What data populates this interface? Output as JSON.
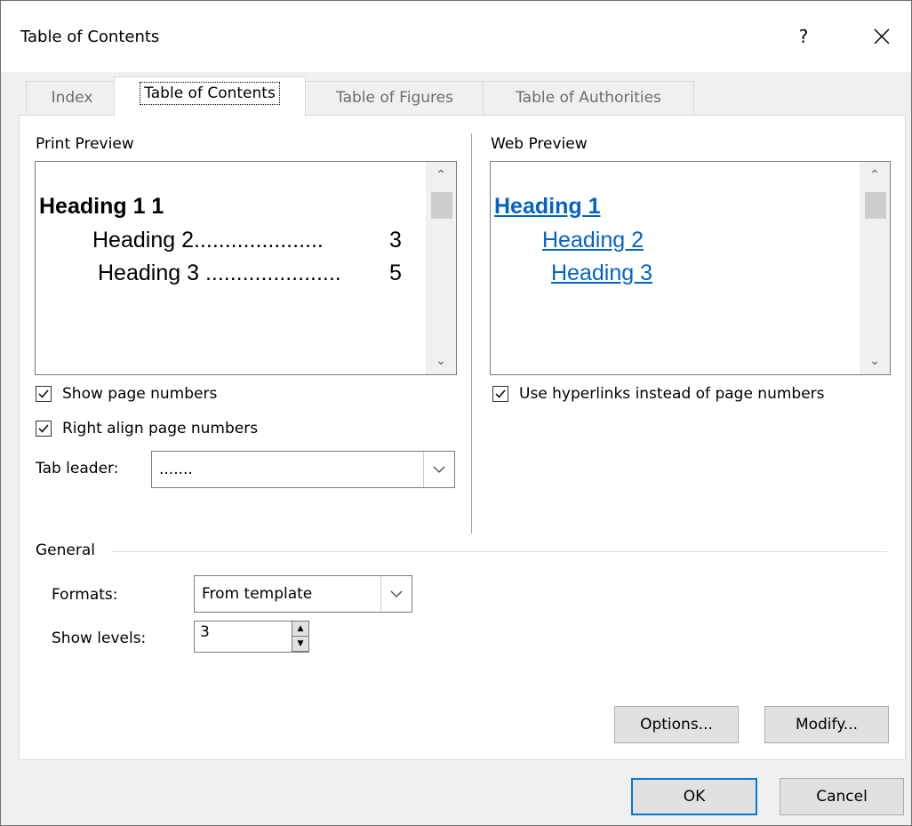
{
  "window": {
    "title": "Table of Contents",
    "help_glyph": "?",
    "close_glyph": "✕"
  },
  "tabs": [
    {
      "label": "Index"
    },
    {
      "label": "Table of Contents"
    },
    {
      "label": "Table of Figures"
    },
    {
      "label": "Table of Authorities"
    }
  ],
  "print_preview": {
    "label": "Print Preview",
    "lines": [
      {
        "text": "Heading 1 1"
      },
      {
        "text": "Heading 2",
        "leader": ".....................",
        "page": "3"
      },
      {
        "text": "Heading 3",
        "leader": "......................",
        "page": "5"
      }
    ]
  },
  "web_preview": {
    "label": "Web Preview",
    "lines": [
      "Heading 1",
      "Heading 2",
      "Heading 3"
    ]
  },
  "options_left": {
    "show_page_numbers": {
      "label": "Show page numbers",
      "checked": true
    },
    "right_align": {
      "label": "Right align page numbers",
      "checked": true
    },
    "tab_leader": {
      "label": "Tab leader:",
      "value": "......."
    }
  },
  "options_right": {
    "use_hyperlinks": {
      "label": "Use hyperlinks instead of page numbers",
      "checked": true
    }
  },
  "general": {
    "label": "General",
    "formats": {
      "label": "Formats:",
      "value": "From template"
    },
    "show_levels": {
      "label": "Show levels:",
      "value": "3"
    }
  },
  "buttons": {
    "options": "Options...",
    "modify": "Modify...",
    "ok": "OK",
    "cancel": "Cancel"
  },
  "colors": {
    "accent": "#0078d7",
    "link": "#0563c1",
    "link_bold": "#0563c1"
  }
}
